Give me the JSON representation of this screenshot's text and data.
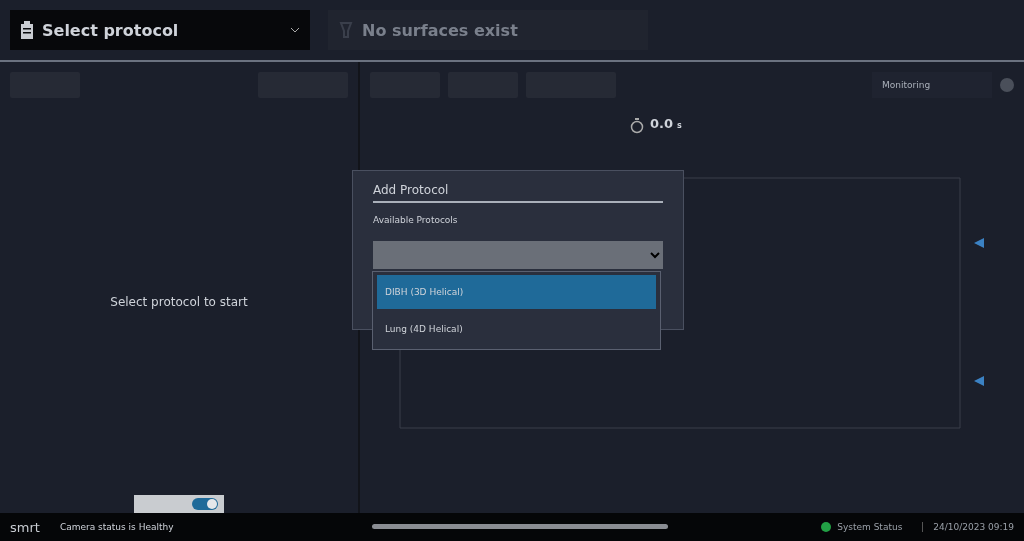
{
  "header": {
    "protocol_select": "Select protocol",
    "surface_select": "No surfaces exist"
  },
  "left_panel": {
    "message": "Select protocol to start",
    "toggle": {
      "on": true
    }
  },
  "right_panel": {
    "mode": "Monitoring",
    "timer": {
      "value": "0.0",
      "unit": "s"
    }
  },
  "dialog": {
    "title": "Add Protocol",
    "label": "Available Protocols",
    "options": [
      {
        "label": "DIBH (3D Helical)",
        "selected": true
      },
      {
        "label": "Lung (4D Helical)",
        "selected": false
      }
    ]
  },
  "status_bar": {
    "logo": "smrt",
    "camera_status": "Camera status is Healthy",
    "system_status": "System Status",
    "datetime": "24/10/2023 09:19"
  }
}
